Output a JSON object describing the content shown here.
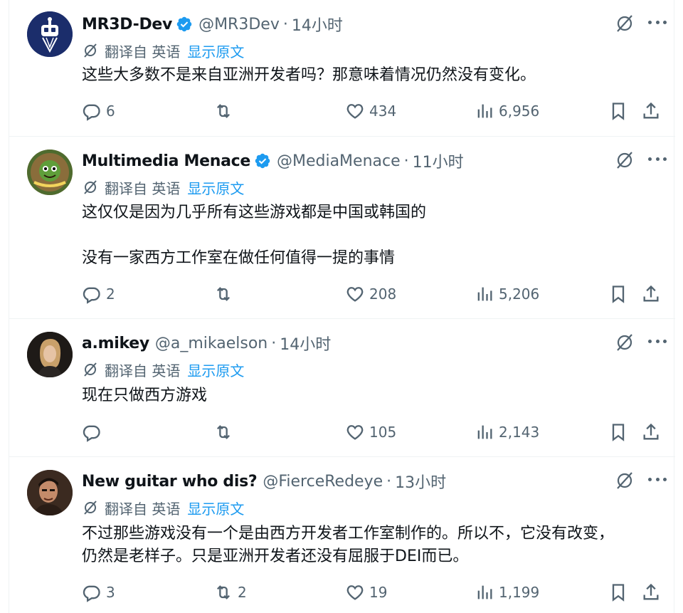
{
  "colors": {
    "accent": "#1d9bf0",
    "muted": "#536471",
    "text": "#0f1419",
    "verified": "#1d9bf0"
  },
  "translate": {
    "from_label": "翻译自 英语",
    "show_original": "显示原文"
  },
  "tweets": [
    {
      "name": "MR3D-Dev",
      "verified": true,
      "handle": "@MR3Dev",
      "time": "14小时",
      "lines": [
        "这些大多数不是来自亚洲开发者吗？那意味着情况仍然没有变化。"
      ],
      "replies": "6",
      "retweets": "",
      "likes": "434",
      "views": "6,956"
    },
    {
      "name": "Multimedia Menace",
      "verified": true,
      "handle": "@MediaMenace",
      "time": "11小时",
      "lines": [
        "这仅仅是因为几乎所有这些游戏都是中国或韩国的",
        "",
        "没有一家西方工作室在做任何值得一提的事情"
      ],
      "replies": "2",
      "retweets": "",
      "likes": "208",
      "views": "5,206"
    },
    {
      "name": "a.mikey",
      "verified": false,
      "handle": "@a_mikaelson",
      "time": "14小时",
      "lines": [
        "现在只做西方游戏"
      ],
      "replies": "",
      "retweets": "",
      "likes": "105",
      "views": "2,143"
    },
    {
      "name": "New guitar who dis?",
      "verified": false,
      "handle": "@FierceRedeye",
      "time": "13小时",
      "lines": [
        "不过那些游戏没有一个是由西方开发者工作室制作的。所以不，它没有改变，",
        "仍然是老样子。只是亚洲开发者还没有屈服于DEI而已。"
      ],
      "replies": "3",
      "retweets": "2",
      "likes": "19",
      "views": "1,199"
    }
  ]
}
